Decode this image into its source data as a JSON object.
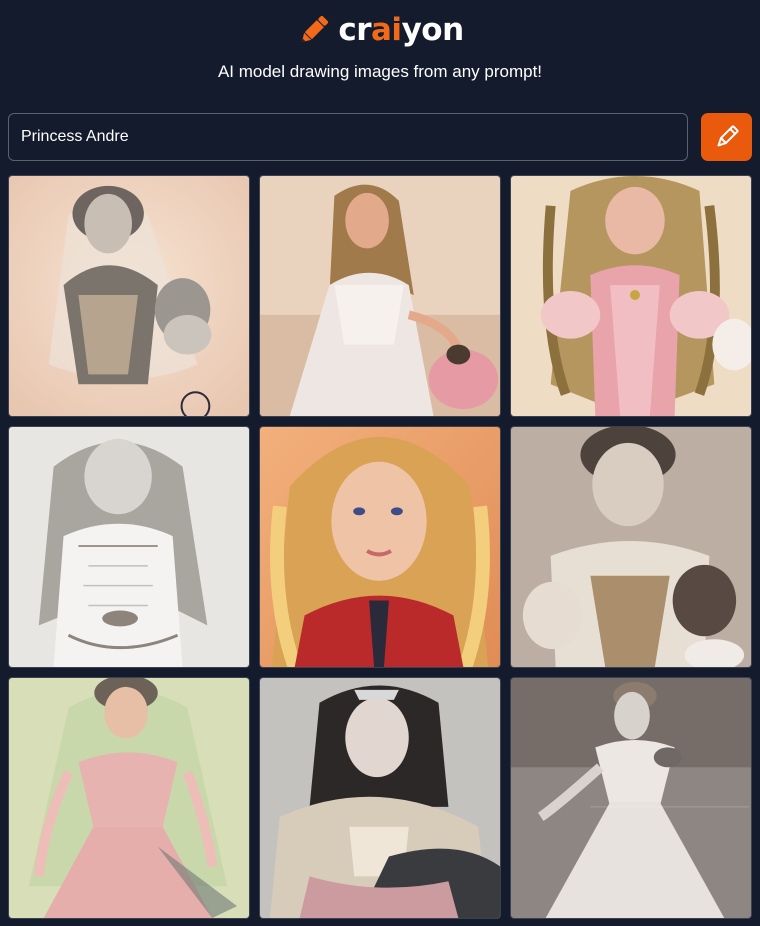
{
  "brand": {
    "prefix": "cr",
    "accent": "ai",
    "suffix": "yon",
    "accent_color": "#f26a19",
    "icon": "pencil-icon"
  },
  "tagline": "AI model drawing images from any prompt!",
  "prompt": {
    "value": "Princess Andre",
    "placeholder": ""
  },
  "draw_button": {
    "icon": "pencil-icon",
    "color": "#ea5a0c"
  },
  "results": {
    "images": [
      {
        "name": "result-image-1",
        "style": "sepia portrait, veiled woman in corset dress"
      },
      {
        "name": "result-image-2",
        "style": "painting, curly-haired girl in white gown"
      },
      {
        "name": "result-image-3",
        "style": "painting, long golden curls, pink dress"
      },
      {
        "name": "result-image-4",
        "style": "sketch, girl with long hair, white blouse"
      },
      {
        "name": "result-image-5",
        "style": "digital painting, blonde girl in red jacket"
      },
      {
        "name": "result-image-6",
        "style": "sepia photo, woman in lace gown"
      },
      {
        "name": "result-image-7",
        "style": "watercolor, woman in pink ball gown"
      },
      {
        "name": "result-image-8",
        "style": "hand-colored photo, tiara and ruffled dress"
      },
      {
        "name": "result-image-9",
        "style": "vintage photo, woman in white gown"
      }
    ]
  }
}
